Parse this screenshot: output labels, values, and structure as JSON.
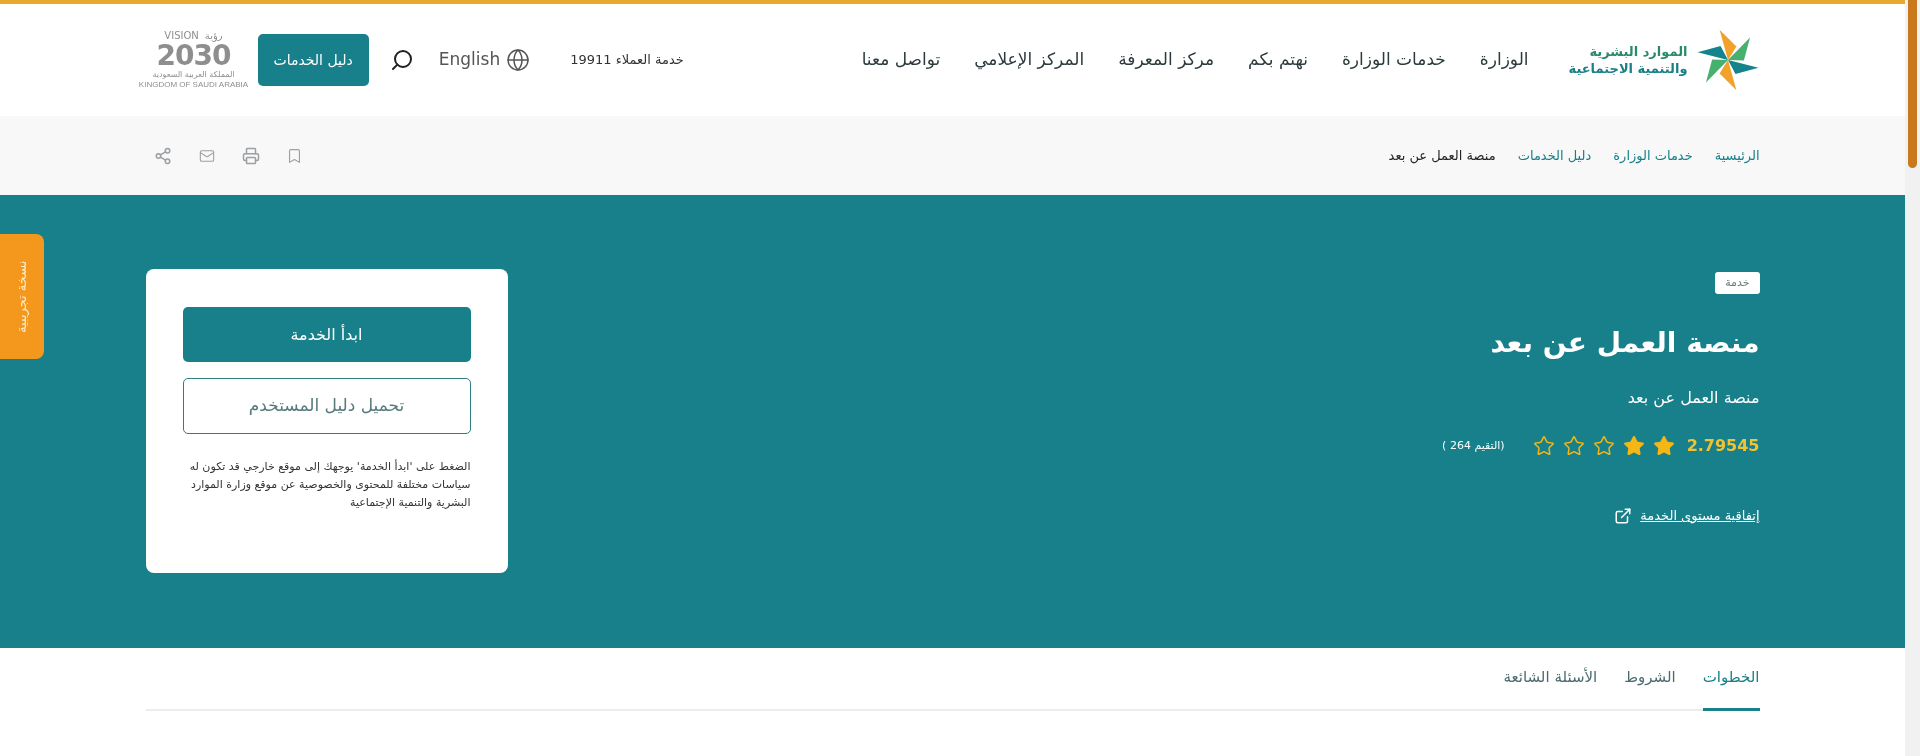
{
  "header": {
    "logo": {
      "lines": [
        "الموارد البشرية",
        "والتنمية الاجتماعية"
      ]
    },
    "nav": [
      "الوزارة",
      "خدمات الوزارة",
      "نهتم بكم",
      "مركز المعرفة",
      "المركز الإعلامي",
      "تواصل معنا"
    ],
    "customer_service": "خدمة العملاء 19911",
    "language": "English",
    "services_button": "دليل الخدمات",
    "vision_logo": {
      "latin": "VISION",
      "arabic": "رؤية",
      "year": "2030",
      "country_arabic": "المملكة العربية السعودية",
      "country_latin": "KINGDOM OF SAUDI ARABIA"
    }
  },
  "breadcrumb": [
    {
      "label": "الرئيسية",
      "current": false
    },
    {
      "label": "خدمات الوزارة",
      "current": false
    },
    {
      "label": "دليل الخدمات",
      "current": false
    },
    {
      "label": "منصة العمل عن بعد",
      "current": true
    }
  ],
  "beta_tab": "نسخة تجريبية",
  "service": {
    "badge": "خدمة",
    "title": "منصة العمل عن بعد",
    "subtitle": "منصة العمل عن بعد",
    "rating": "2.79545",
    "stars": 2,
    "rating_count": "(التقيم 264 )",
    "sla_link": "إتفاقية مستوى الخدمة"
  },
  "action_card": {
    "buttons": [
      {
        "label": "ابدأ الخدمة",
        "kind": "primary"
      },
      {
        "label": "تحميل دليل المستخدم",
        "kind": "outline"
      }
    ],
    "note": "الضغط على 'ابدأ الخدمة' يوجهك إلى موقع خارجي قد تكون له سياسات مختلفة للمحتوى والخصوصية عن موقع وزارة الموارد البشرية والتنمية الإجتماعية"
  },
  "tabs": [
    {
      "label": "الخطوات",
      "selected": true
    },
    {
      "label": "الشروط",
      "selected": false
    },
    {
      "label": "الأسئلة الشائعة",
      "selected": false
    }
  ]
}
